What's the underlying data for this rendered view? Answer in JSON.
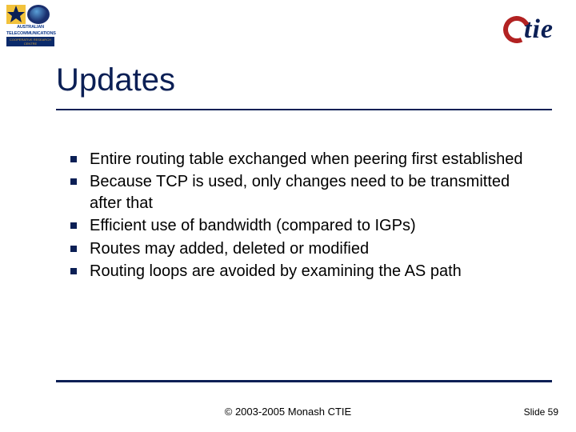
{
  "header": {
    "logo_left_line1": "AUSTRALIAN",
    "logo_left_line2": "TELECOMMUNICATIONS",
    "logo_left_sub": "COOPERATIVE RESEARCH CENTRE",
    "logo_right_text": "tie"
  },
  "title": "Updates",
  "bullets": [
    "Entire routing table exchanged when peering first established",
    "Because TCP is used, only changes need to be transmitted after that",
    "Efficient use of bandwidth (compared to IGPs)",
    "Routes may added, deleted or modified",
    "Routing loops are avoided by examining the AS path"
  ],
  "footer": {
    "copyright": "© 2003-2005 Monash CTIE",
    "slide_label": "Slide 59"
  }
}
